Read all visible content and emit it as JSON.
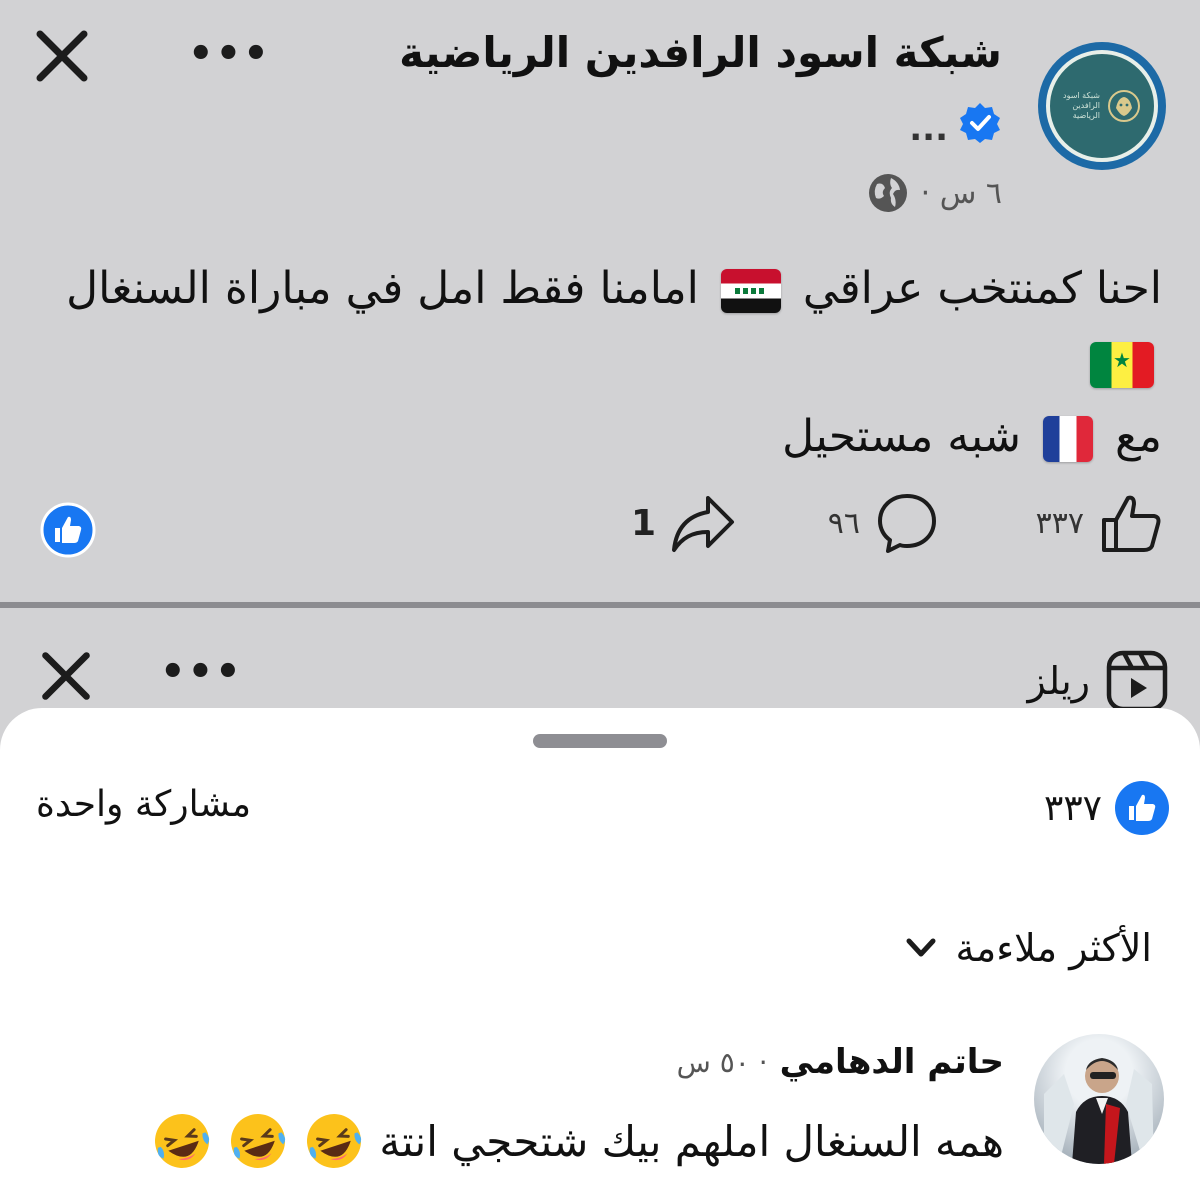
{
  "post": {
    "page_name": "شبكة اسود الرافدين الرياضية",
    "name_more": "...",
    "time": "٦ س ·",
    "logo_text": "شبكة اسود الرافدين الرياضية",
    "text_line1_a": "احنا كمنتخب عراقي",
    "text_line1_b": "امامنا فقط امل في مباراة السنغال",
    "text_line2_a": "مع",
    "text_line2_b": "شبه مستحيل",
    "likes": "٣٣٧",
    "comments": "٩٦",
    "shares": "1",
    "more_label": "•••"
  },
  "reels": {
    "label": "ريلز",
    "more_label": "•••"
  },
  "sheet": {
    "likes": "٣٣٧",
    "shares_text": "مشاركة واحدة",
    "sort_label": "الأكثر ملاءمة"
  },
  "comment": {
    "author": "حاتم الدهامي",
    "time": "· ٥٠ س",
    "text": "همه السنغال املهم بيك شتحجي انتة"
  },
  "colors": {
    "background_dim": "#d2d2d4",
    "facebook_blue": "#1877f2",
    "sheet_bg": "#ffffff"
  },
  "icons": [
    "close-icon",
    "more-icon",
    "verified-icon",
    "globe-icon",
    "like-icon",
    "comment-icon",
    "share-icon",
    "reels-icon",
    "chevron-down-icon",
    "laughing-emoji"
  ]
}
